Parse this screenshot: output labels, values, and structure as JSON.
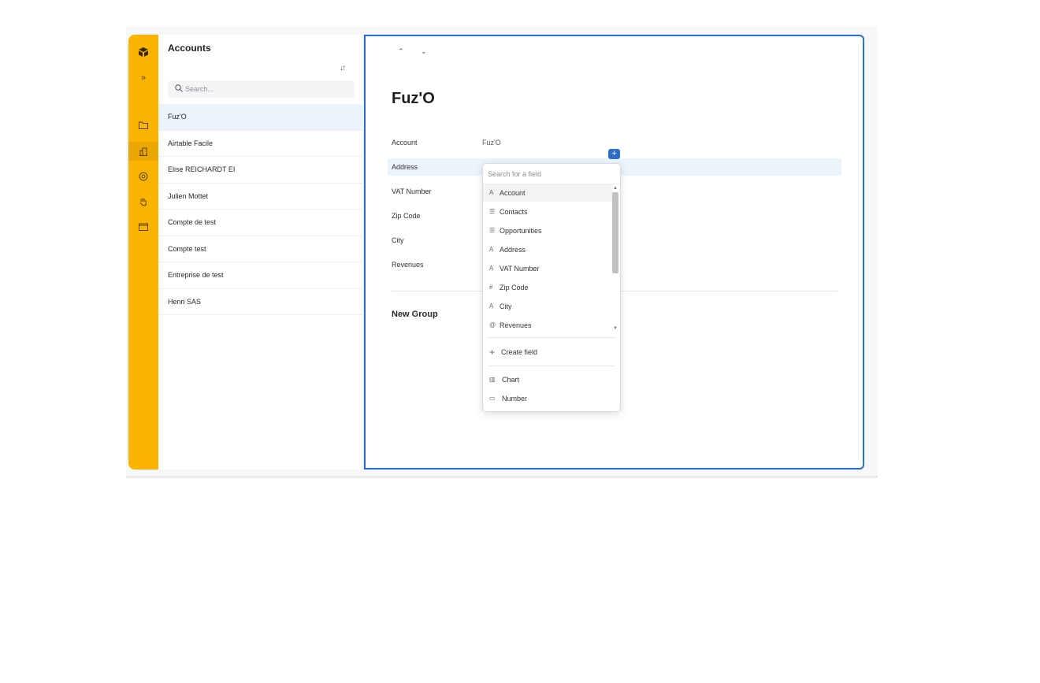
{
  "rail": {
    "icons": [
      "airtable-logo-icon",
      "expand-icon",
      "folder-icon",
      "building-icon",
      "support-icon",
      "hand-icon",
      "archive-icon"
    ]
  },
  "accounts": {
    "title": "Accounts",
    "search_placeholder": "Search...",
    "items": [
      {
        "name": "Fuz'O"
      },
      {
        "name": "Airtable Facile"
      },
      {
        "name": "Elise REICHARDT EI"
      },
      {
        "name": "Julien Mottet"
      },
      {
        "name": "Compte de test"
      },
      {
        "name": "Compte test"
      },
      {
        "name": "Entreprise de test"
      },
      {
        "name": "Henri SAS"
      }
    ]
  },
  "detail": {
    "title": "Fuz'O",
    "fields": [
      {
        "label": "Account",
        "value": "Fuz'O"
      },
      {
        "label": "Address",
        "value": ""
      },
      {
        "label": "VAT Number",
        "value": ""
      },
      {
        "label": "Zip Code",
        "value": ""
      },
      {
        "label": "City",
        "value": ""
      },
      {
        "label": "Revenues",
        "value": ""
      }
    ],
    "group_title": "New Group",
    "add_button": "+"
  },
  "dropdown": {
    "search_placeholder": "Search for a field",
    "items": [
      {
        "icon": "A",
        "label": "Account"
      },
      {
        "icon": "☰",
        "label": "Contacts"
      },
      {
        "icon": "☰",
        "label": "Opportunities"
      },
      {
        "icon": "A",
        "label": "Address"
      },
      {
        "icon": "A",
        "label": "VAT Number"
      },
      {
        "icon": "#",
        "label": "Zip Code"
      },
      {
        "icon": "A",
        "label": "City"
      },
      {
        "icon": "@",
        "label": "Revenues"
      }
    ],
    "create_label": "Create field",
    "create_icon": "+",
    "extra": [
      {
        "icon": "▥",
        "label": "Chart"
      },
      {
        "icon": "▭",
        "label": "Number"
      }
    ]
  }
}
